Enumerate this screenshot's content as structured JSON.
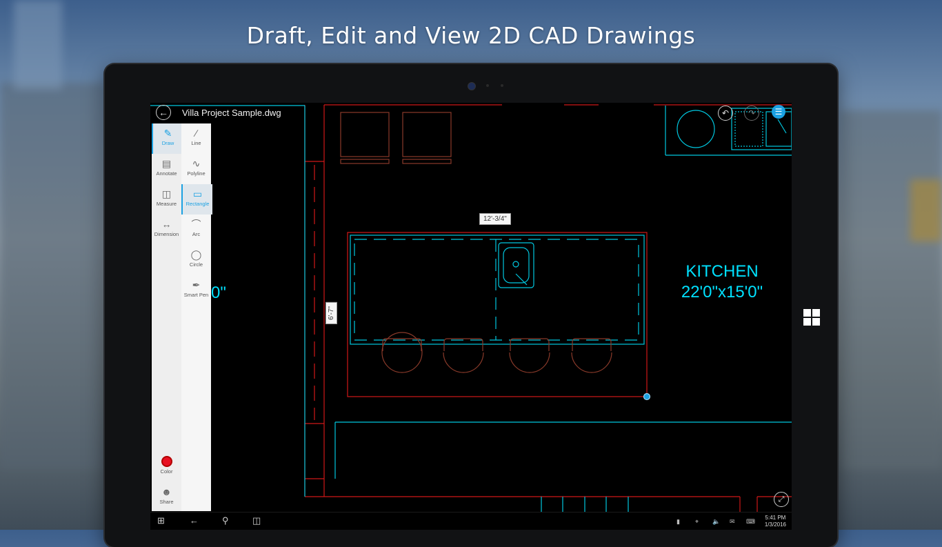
{
  "headline": "Draft, Edit and View 2D CAD Drawings",
  "app": {
    "file_title": "Villa Project Sample.dwg",
    "back_icon": "back-arrow-icon"
  },
  "tools_primary": [
    {
      "label": "Draw",
      "icon": "draw-icon",
      "active": true
    },
    {
      "label": "Annotate",
      "icon": "annotate-icon",
      "active": false
    },
    {
      "label": "Measure",
      "icon": "measure-icon",
      "active": false
    },
    {
      "label": "Dimension",
      "icon": "dimension-icon",
      "active": false
    }
  ],
  "tools_secondary": [
    {
      "label": "Line",
      "icon": "line-icon",
      "active": false
    },
    {
      "label": "Polyline",
      "icon": "polyline-icon",
      "active": false
    },
    {
      "label": "Rectangle",
      "icon": "rectangle-icon",
      "active": true
    },
    {
      "label": "Arc",
      "icon": "arc-icon",
      "active": false
    },
    {
      "label": "Circle",
      "icon": "circle-icon",
      "active": false
    },
    {
      "label": "Smart Pen",
      "icon": "smart-pen-icon",
      "active": false
    }
  ],
  "bottom_tools": {
    "color_label": "Color",
    "share_label": "Share"
  },
  "canvas": {
    "dimension_horizontal": "12'-3/4\"",
    "dimension_vertical": "6'-7\"",
    "room_name": "KITCHEN",
    "room_size": "22'0\"x15'0\"",
    "partial_text": "0\""
  },
  "colors": {
    "accent": "#1ba1e2",
    "cad_cyan": "#00e1ff",
    "cad_red": "#d01818",
    "cad_brown": "#8a3a2a",
    "toolbar_bg": "#eeeeee"
  },
  "taskbar": {
    "time": "5:41 PM",
    "date": "1/3/2016",
    "start_icon": "windows-start-icon",
    "back_icon": "taskbar-back-icon",
    "search_icon": "search-icon",
    "task_view_icon": "task-view-icon"
  }
}
